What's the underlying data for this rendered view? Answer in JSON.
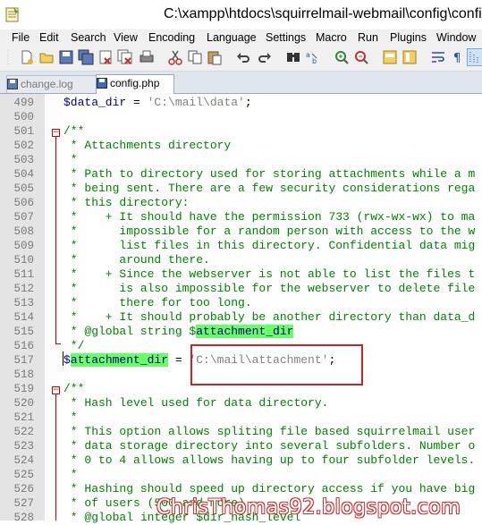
{
  "window": {
    "title": "C:\\xampp\\htdocs\\squirrelmail-webmail\\config\\config"
  },
  "menu": [
    "File",
    "Edit",
    "Search",
    "View",
    "Encoding",
    "Language",
    "Settings",
    "Macro",
    "Run",
    "Plugins",
    "Window"
  ],
  "toolbar": {
    "icons": [
      "new-file-icon",
      "open-file-icon",
      "save-icon",
      "save-all-icon",
      "close-icon",
      "close-all-icon",
      "print-icon",
      "cut-icon",
      "copy-icon",
      "paste-icon",
      "undo-icon",
      "redo-icon",
      "find-icon",
      "replace-icon",
      "zoom-in-icon",
      "zoom-out-icon",
      "sync-vertical-icon",
      "sync-horizontal-icon",
      "word-wrap-icon",
      "show-all-characters-icon",
      "indent-guide-icon"
    ]
  },
  "tabs": [
    {
      "label": "change.log",
      "active": false
    },
    {
      "label": "config.php",
      "active": true
    }
  ],
  "editor": {
    "lines": [
      {
        "n": "499",
        "t": "$data_dir = 'C:\\mail\\data';"
      },
      {
        "n": "500",
        "t": ""
      },
      {
        "n": "501",
        "t": "/**"
      },
      {
        "n": "502",
        "t": " * Attachments directory"
      },
      {
        "n": "503",
        "t": " *"
      },
      {
        "n": "504",
        "t": " * Path to directory used for storing attachments while a m"
      },
      {
        "n": "505",
        "t": " * being sent. There are a few security considerations rega"
      },
      {
        "n": "506",
        "t": " * this directory:"
      },
      {
        "n": "507",
        "t": " *    + It should have the permission 733 (rwx-wx-wx) to ma"
      },
      {
        "n": "508",
        "t": " *      impossible for a random person with access to the w"
      },
      {
        "n": "509",
        "t": " *      list files in this directory. Confidential data mig"
      },
      {
        "n": "510",
        "t": " *      around there."
      },
      {
        "n": "511",
        "t": " *    + Since the webserver is not able to list the files t"
      },
      {
        "n": "512",
        "t": " *      is also impossible for the webserver to delete file"
      },
      {
        "n": "513",
        "t": " *      there for too long."
      },
      {
        "n": "514",
        "t": " *    + It should probably be another directory than data_d"
      },
      {
        "n": "515",
        "t": " * @global string $attachment_dir"
      },
      {
        "n": "516",
        "t": " */"
      },
      {
        "n": "517",
        "t": "$attachment_dir = 'C:\\mail\\attachment';"
      },
      {
        "n": "518",
        "t": ""
      },
      {
        "n": "519",
        "t": "/**"
      },
      {
        "n": "520",
        "t": " * Hash level used for data directory."
      },
      {
        "n": "521",
        "t": " *"
      },
      {
        "n": "522",
        "t": " * This option allows spliting file based squirrelmail user"
      },
      {
        "n": "523",
        "t": " * data storage directory into several subfolders. Number o"
      },
      {
        "n": "524",
        "t": " * 0 to 4 allows allows having up to four subfolder levels."
      },
      {
        "n": "525",
        "t": " *"
      },
      {
        "n": "526",
        "t": " * Hashing should speed up directory access if you have big"
      },
      {
        "n": "527",
        "t": " * of users (500 and more)."
      },
      {
        "n": "528",
        "t": " * @global integer $dir_hash_level"
      }
    ],
    "highlight_word": "attachment_dir"
  },
  "watermark": "ChrisThomas92.blogspot.com",
  "colors": {
    "comment": "#008000",
    "variable": "#000080",
    "string": "#808080",
    "highlight": "#66ff66",
    "annotation_box": "#cc2222"
  }
}
